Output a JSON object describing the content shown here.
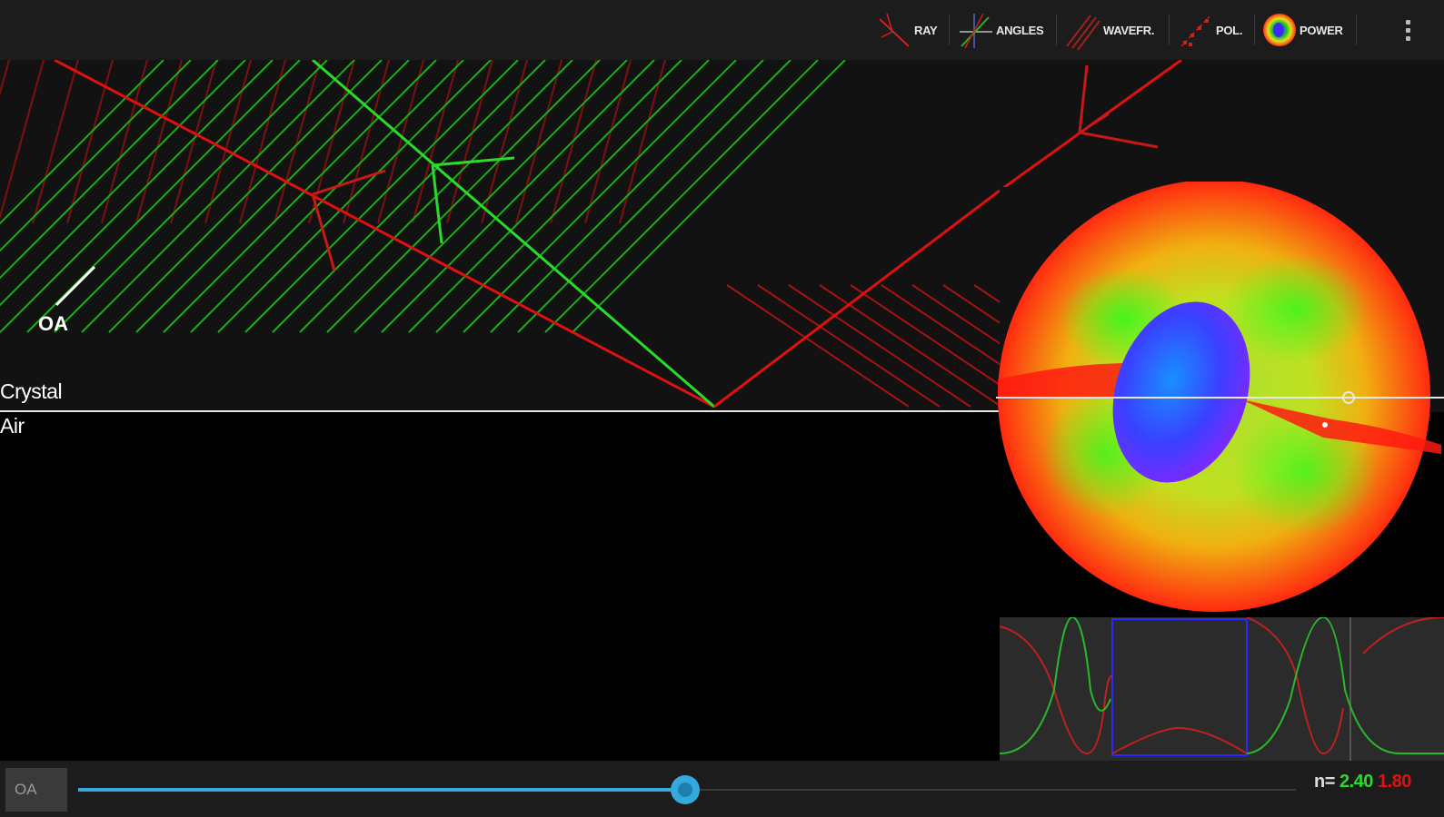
{
  "toolbar": {
    "ray_label": "RAY",
    "angles_label": "ANGLES",
    "wavefr_label": "WAVEFR.",
    "pol_label": "POL.",
    "power_label": "POWER"
  },
  "scene": {
    "crystal_label": "Crystal",
    "air_label": "Air",
    "oa_label": "OA"
  },
  "bottom": {
    "oa_button_label": "OA",
    "slider_value": 0.5,
    "n_prefix": "n=",
    "n_ordinary": "2.40",
    "n_extraordinary": "1.80"
  },
  "colors": {
    "ordinary": "#2adb2a",
    "extraordinary": "#e01010",
    "accent": "#33a9dc"
  }
}
